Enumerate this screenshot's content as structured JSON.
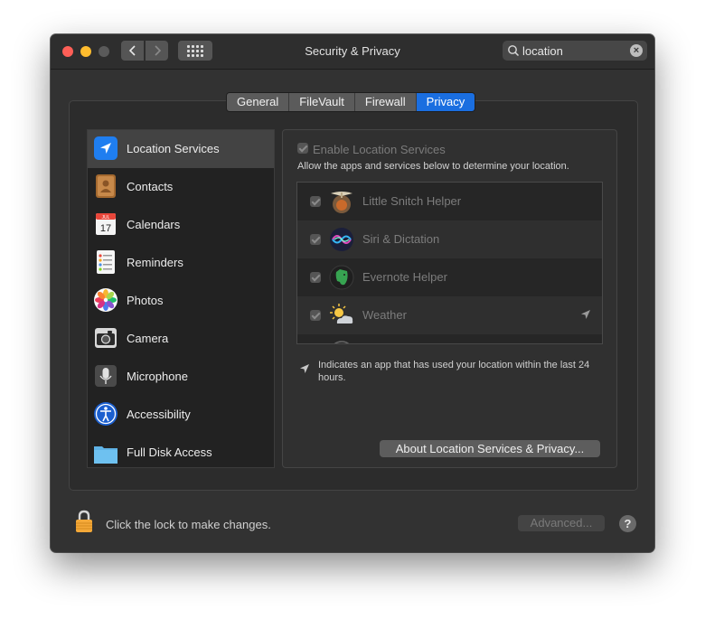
{
  "window": {
    "title": "Security & Privacy"
  },
  "search": {
    "value": "location"
  },
  "tabs": [
    {
      "label": "General",
      "active": false
    },
    {
      "label": "FileVault",
      "active": false
    },
    {
      "label": "Firewall",
      "active": false
    },
    {
      "label": "Privacy",
      "active": true
    }
  ],
  "sidebar": {
    "items": [
      {
        "label": "Location Services",
        "icon": "location-arrow-icon",
        "selected": true
      },
      {
        "label": "Contacts",
        "icon": "contacts-book-icon"
      },
      {
        "label": "Calendars",
        "icon": "calendar-icon",
        "badge_month": "JUL",
        "badge_day": "17"
      },
      {
        "label": "Reminders",
        "icon": "reminders-list-icon"
      },
      {
        "label": "Photos",
        "icon": "photos-flower-icon"
      },
      {
        "label": "Camera",
        "icon": "camera-icon"
      },
      {
        "label": "Microphone",
        "icon": "microphone-icon"
      },
      {
        "label": "Accessibility",
        "icon": "accessibility-icon"
      },
      {
        "label": "Full Disk Access",
        "icon": "folder-icon"
      }
    ]
  },
  "location": {
    "enable_label": "Enable Location Services",
    "enabled": true,
    "description": "Allow the apps and services below to determine your location.",
    "apps": [
      {
        "name": "Little Snitch Helper",
        "checked": true,
        "icon": "little-snitch-icon"
      },
      {
        "name": "Siri & Dictation",
        "checked": true,
        "icon": "siri-icon"
      },
      {
        "name": "Evernote Helper",
        "checked": true,
        "icon": "evernote-icon"
      },
      {
        "name": "Weather",
        "checked": true,
        "icon": "weather-icon",
        "recent_use": true
      }
    ],
    "note": "Indicates an app that has used your location within the last 24 hours.",
    "about_button": "About Location Services & Privacy..."
  },
  "footer": {
    "lock_text": "Click the lock to make changes.",
    "advanced_button": "Advanced...",
    "help": "?"
  },
  "colors": {
    "accent": "#1a6ee0",
    "window_bg": "#323232"
  }
}
